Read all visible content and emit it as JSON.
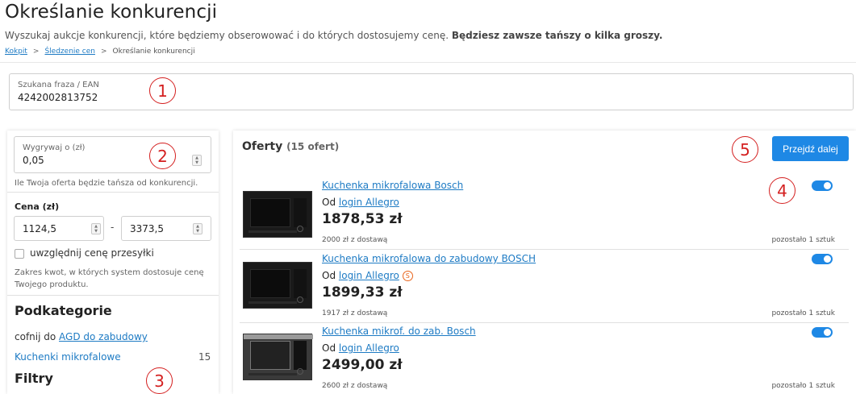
{
  "header": {
    "title": "Określanie konkurencji",
    "subtitle_normal": "Wyszukaj aukcje konkurencji, które będziemy obserowować i do których dostosujemy cenę. ",
    "subtitle_bold": "Będziesz zawsze tańszy o kilka groszy."
  },
  "breadcrumb": {
    "items": [
      "Kokpit",
      "Śledzenie cen",
      "Określanie konkurencji"
    ],
    "separator": ">"
  },
  "search": {
    "label": "Szukana fraza / EAN",
    "value": "4242002813752"
  },
  "markers": [
    "1",
    "2",
    "3",
    "4",
    "5"
  ],
  "filters": {
    "win_by": {
      "label": "Wygrywaj o (zł)",
      "value": "0,05",
      "hint": "Ile Twoja oferta będzie tańsza od konkurencji."
    },
    "price": {
      "label": "Cena (zł)",
      "min": "1124,5",
      "max": "3373,5",
      "separator": "-",
      "include_shipping_label": "uwzględnij cenę przesyłki",
      "include_shipping_checked": false,
      "hint_line1": "Zakres kwot, w których system dostosuje cenę",
      "hint_line2": "Twojego produktu."
    },
    "subcategories": {
      "heading": "Podkategorie",
      "back_prefix": "cofnij do ",
      "back_link": "AGD do zabudowy",
      "items": [
        {
          "label": "Kuchenki mikrofalowe",
          "count": "15"
        }
      ]
    },
    "filters_heading": "Filtry"
  },
  "offers": {
    "title": "Oferty",
    "count_label": "(15 ofert)",
    "next_button": "Przejdź dalej",
    "items": [
      {
        "title": "Kuchenka mikrofalowa Bosch",
        "seller_prefix": "Od ",
        "seller": "login Allegro",
        "super_seller": false,
        "price": "1878,53 zł",
        "shipping": "2000 zł z dostawą",
        "stock": "pozostało 1 sztuk",
        "enabled": true
      },
      {
        "title": "Kuchenka mikrofalowa do zabudowy BOSCH",
        "seller_prefix": "Od ",
        "seller": "login Allegro",
        "super_seller": true,
        "super_seller_badge": "S",
        "price": "1899,33 zł",
        "shipping": "1917 zł z dostawą",
        "stock": "pozostało 1 sztuk",
        "enabled": true
      },
      {
        "title": "Kuchenka mikrof. do zab. Bosch",
        "seller_prefix": "Od ",
        "seller": "login Allegro",
        "super_seller": false,
        "price": "2499,00 zł",
        "shipping": "2600 zł z dostawą",
        "stock": "pozostało 1 sztuk",
        "enabled": true
      }
    ]
  },
  "colors": {
    "accent": "#1e88e5",
    "link": "#1e7bc4",
    "marker": "#d42020",
    "super_seller": "#e8641b"
  }
}
